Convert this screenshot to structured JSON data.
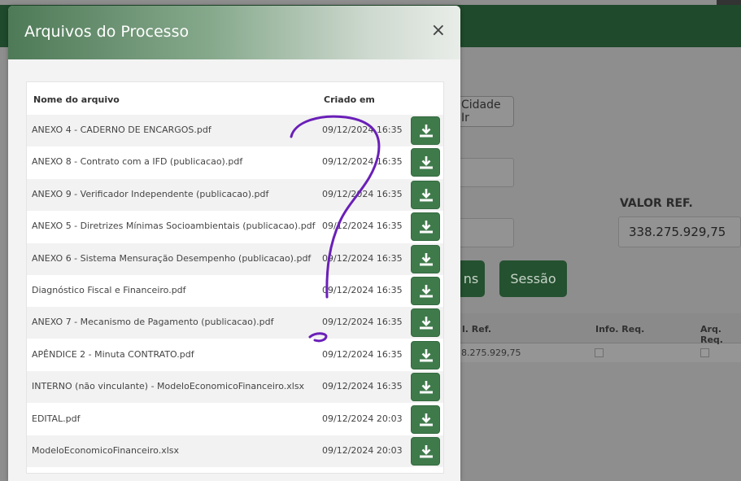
{
  "background": {
    "partial_button": "Cidade Ir",
    "valor_ref_label": "VALOR REF.",
    "valor_ref_value": "338.275.929,75",
    "button_partial": "ns",
    "sessao_button": "Sessão",
    "table_headers": [
      "l. Ref.",
      "Info. Req.",
      "Arq. Req."
    ],
    "table_value": "8.275.929,75"
  },
  "modal": {
    "title": "Arquivos do Processo",
    "close_label": "×",
    "columns": {
      "name": "Nome do arquivo",
      "date": "Criado em"
    },
    "files": [
      {
        "name": "ANEXO 4 - CADERNO DE ENCARGOS.pdf",
        "date": "09/12/2024 16:35"
      },
      {
        "name": "ANEXO 8 - Contrato com a IFD (publicacao).pdf",
        "date": "09/12/2024 16:35"
      },
      {
        "name": "ANEXO 9 - Verificador Independente (publicacao).pdf",
        "date": "09/12/2024 16:35"
      },
      {
        "name": "ANEXO 5 - Diretrizes Mínimas Socioambientais (publicacao).pdf",
        "date": "09/12/2024 16:35"
      },
      {
        "name": "ANEXO 6 - Sistema Mensuração Desempenho (publicacao).pdf",
        "date": "09/12/2024 16:35"
      },
      {
        "name": "Diagnóstico Fiscal e Financeiro.pdf",
        "date": "09/12/2024 16:35"
      },
      {
        "name": "ANEXO 7 - Mecanismo de Pagamento (publicacao).pdf",
        "date": "09/12/2024 16:35"
      },
      {
        "name": "APÊNDICE 2 - Minuta CONTRATO.pdf",
        "date": "09/12/2024 16:35"
      },
      {
        "name": "INTERNO (não vinculante) - ModeloEconomicoFinanceiro.xlsx",
        "date": "09/12/2024 16:35"
      },
      {
        "name": "EDITAL.pdf",
        "date": "09/12/2024 20:03"
      },
      {
        "name": "ModeloEconomicoFinanceiro.xlsx",
        "date": "09/12/2024 20:03"
      }
    ],
    "download_icon": "download-icon"
  },
  "colors": {
    "header_green": "#4e7a57",
    "download_button": "#3f7a4b",
    "scribble": "#6a1fb8"
  }
}
